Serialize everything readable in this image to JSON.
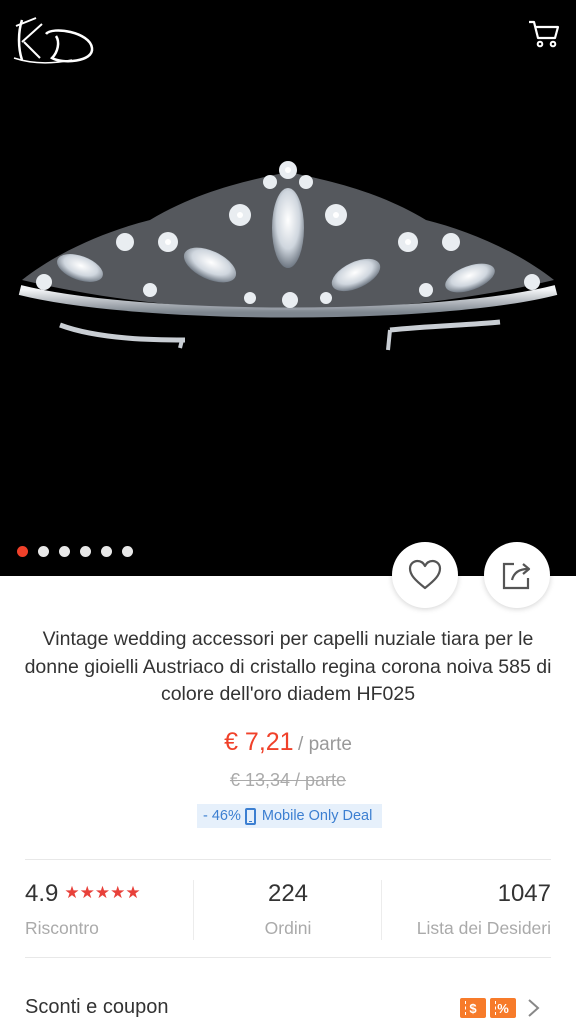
{
  "header": {
    "logo_text": "KD",
    "logo_icon": "kd-logo-icon",
    "cart_icon": "cart-icon"
  },
  "gallery": {
    "image_subject": "silver crystal tiara on black background",
    "image_count": 6,
    "active_index": 0
  },
  "actions": {
    "wishlist_icon": "heart-icon",
    "share_icon": "share-icon"
  },
  "product": {
    "title": "Vintage wedding accessori per capelli nuziale tiara per le donne gioielli Austriaco di cristallo regina corona noiva 585 di colore dell'oro diadem HF025",
    "price": "€ 7,21",
    "price_unit": "/ parte",
    "old_price": "€ 13,34  / parte",
    "discount": "- 46%",
    "deal_label": "Mobile Only Deal"
  },
  "stats": [
    {
      "value": "4.9",
      "label": "Riscontro",
      "stars": "★★★★★"
    },
    {
      "value": "224",
      "label": "Ordini"
    },
    {
      "value": "1047",
      "label": "Lista dei Desideri"
    }
  ],
  "coupons": {
    "label": "Sconti e coupon",
    "icon1": "$",
    "icon2": "%"
  },
  "colors": {
    "accent": "#f0412a",
    "deal_bg": "#e6f0fb",
    "deal_text": "#3c7fd1",
    "coupon_orange": "#f77b2a"
  }
}
